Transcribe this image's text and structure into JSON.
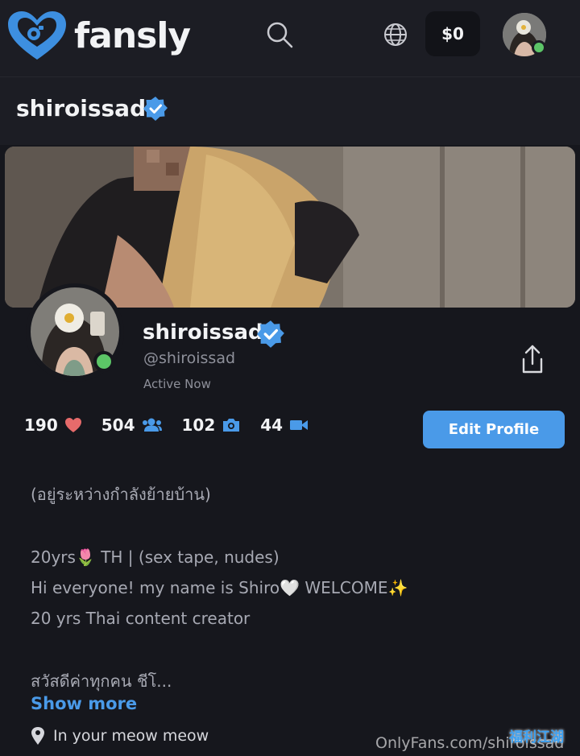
{
  "app": {
    "brand": "fansly"
  },
  "topbar": {
    "wallet_label": "$0",
    "icons": {
      "search": "search-icon",
      "language": "globe-icon"
    }
  },
  "profile": {
    "header_name": "shiroissad",
    "display_name": "shiroissad",
    "handle": "@shiroissad",
    "status": "Active Now",
    "stats": {
      "likes": "190",
      "followers": "504",
      "photos": "102",
      "videos": "44"
    },
    "edit_label": "Edit Profile",
    "bio": {
      "line1": "(อยู่ระหว่างกำลังย้ายบ้าน)",
      "line2": "20yrs🌷 TH | (sex tape, nudes)",
      "line3": "Hi everyone! my name is Shiro🤍 WELCOME✨",
      "line4": "20 yrs Thai content creator",
      "line5": "สวัสดีค่าทุกคน ชีโ..."
    },
    "show_more": "Show more",
    "location": "In your meow meow"
  },
  "watermark": {
    "text": "OnlyFans.com/shiroissad",
    "badge": "福利江湖"
  },
  "colors": {
    "accent": "#4a9ae8",
    "online": "#5cc567",
    "heart": "#e66b6b",
    "background": "#16171d"
  }
}
